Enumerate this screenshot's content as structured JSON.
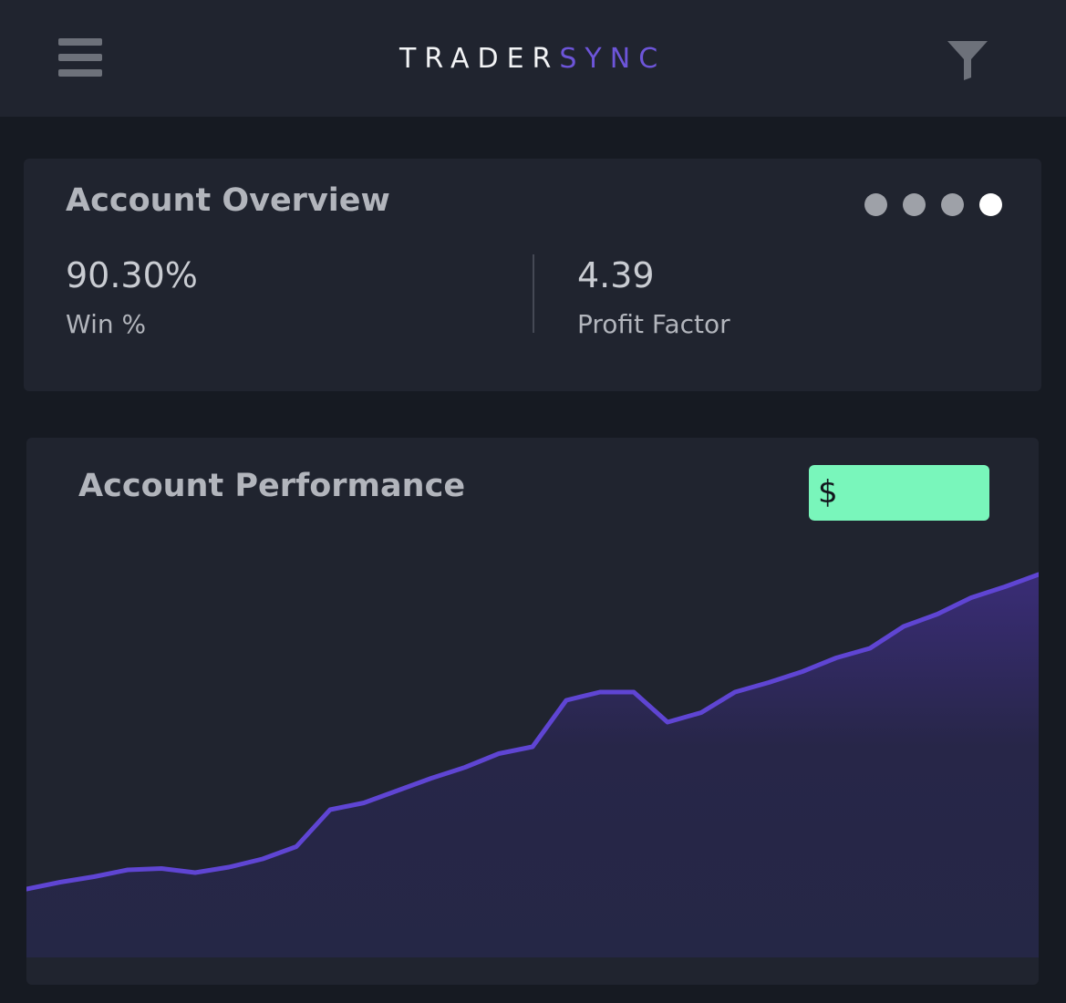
{
  "header": {
    "logo_part1": "TRADER",
    "logo_part2": "SYNC",
    "menu_icon": "hamburger-menu-icon",
    "filter_icon": "filter-funnel-icon"
  },
  "overview": {
    "title": "Account Overview",
    "pager": {
      "count": 4,
      "active_index": 3
    },
    "stats": [
      {
        "value": "90.30%",
        "label": "Win %"
      },
      {
        "value": "4.39",
        "label": "Profit Factor"
      }
    ]
  },
  "performance": {
    "title": "Account Performance",
    "badge": "$"
  },
  "colors": {
    "background": "#161a22",
    "card": "#20242f",
    "accent": "#6d55d9",
    "line": "#5f45d3",
    "badge": "#79f6bb"
  },
  "chart_data": {
    "type": "area",
    "title": "",
    "xlabel": "",
    "ylabel": "",
    "x": [
      0,
      1,
      2,
      3,
      4,
      5,
      6,
      7,
      8,
      9,
      10,
      11,
      12,
      13,
      14,
      15,
      16,
      17,
      18,
      19,
      20,
      21,
      22,
      23,
      24,
      25,
      26,
      27,
      28,
      29,
      30
    ],
    "values": [
      5,
      5.5,
      5.9,
      6.4,
      6.5,
      6.2,
      6.6,
      7.2,
      8.1,
      10.8,
      11.3,
      12.2,
      13.1,
      13.9,
      14.9,
      15.4,
      18.8,
      19.4,
      19.4,
      17.2,
      17.9,
      19.4,
      20.1,
      20.9,
      21.9,
      22.6,
      24.2,
      25.1,
      26.3,
      27.1,
      28
    ]
  }
}
